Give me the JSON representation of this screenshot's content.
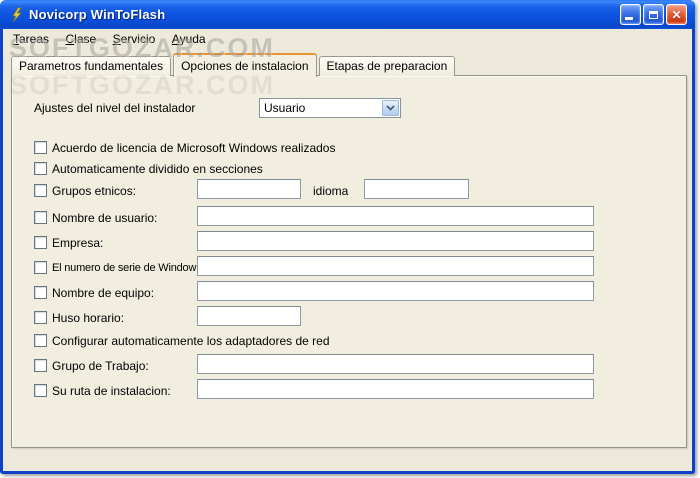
{
  "window": {
    "title": "Novicorp WinToFlash",
    "controls": {
      "close_glyph": "✕"
    }
  },
  "watermark": "SOFTGOZAR.COM",
  "menu": {
    "items": [
      {
        "label": "Tareas"
      },
      {
        "label": "Clase"
      },
      {
        "label": "Servicio"
      },
      {
        "label": "Ayuda"
      }
    ]
  },
  "tabs": [
    {
      "label": "Parametros fundamentales",
      "active": false
    },
    {
      "label": "Opciones de instalacion",
      "active": true
    },
    {
      "label": "Etapas de preparacion",
      "active": false
    }
  ],
  "content": {
    "installer_level": {
      "label": "Ajustes del nivel del instalador",
      "value": "Usuario"
    },
    "rows": [
      {
        "label": "Acuerdo de licencia de Microsoft Windows realizados",
        "checked": false
      },
      {
        "label": "Automaticamente dividido en secciones",
        "checked": false
      },
      {
        "label": "Grupos etnicos:",
        "checked": false,
        "field_value": "",
        "extra_label": "idioma",
        "extra_field_value": ""
      },
      {
        "label": "Nombre de usuario:",
        "checked": false,
        "field_value": ""
      },
      {
        "label": "Empresa:",
        "checked": false,
        "field_value": ""
      },
      {
        "label": "El numero de serie de Window:",
        "checked": false,
        "field_value": ""
      },
      {
        "label": "Nombre de equipo:",
        "checked": false,
        "field_value": ""
      },
      {
        "label": "Huso horario:",
        "checked": false,
        "field_value": ""
      },
      {
        "label": "Configurar automaticamente los adaptadores de red",
        "checked": false
      },
      {
        "label": "Grupo de Trabajo:",
        "checked": false,
        "field_value": ""
      },
      {
        "label": "Su ruta de instalacion:",
        "checked": false,
        "field_value": ""
      }
    ]
  },
  "colors": {
    "titlebar_blue": "#0D54E0",
    "window_border": "#0C41C9",
    "content_beige": "#F1EDDF",
    "active_tab_accent": "#E89232",
    "close_red": "#CC3A12"
  }
}
